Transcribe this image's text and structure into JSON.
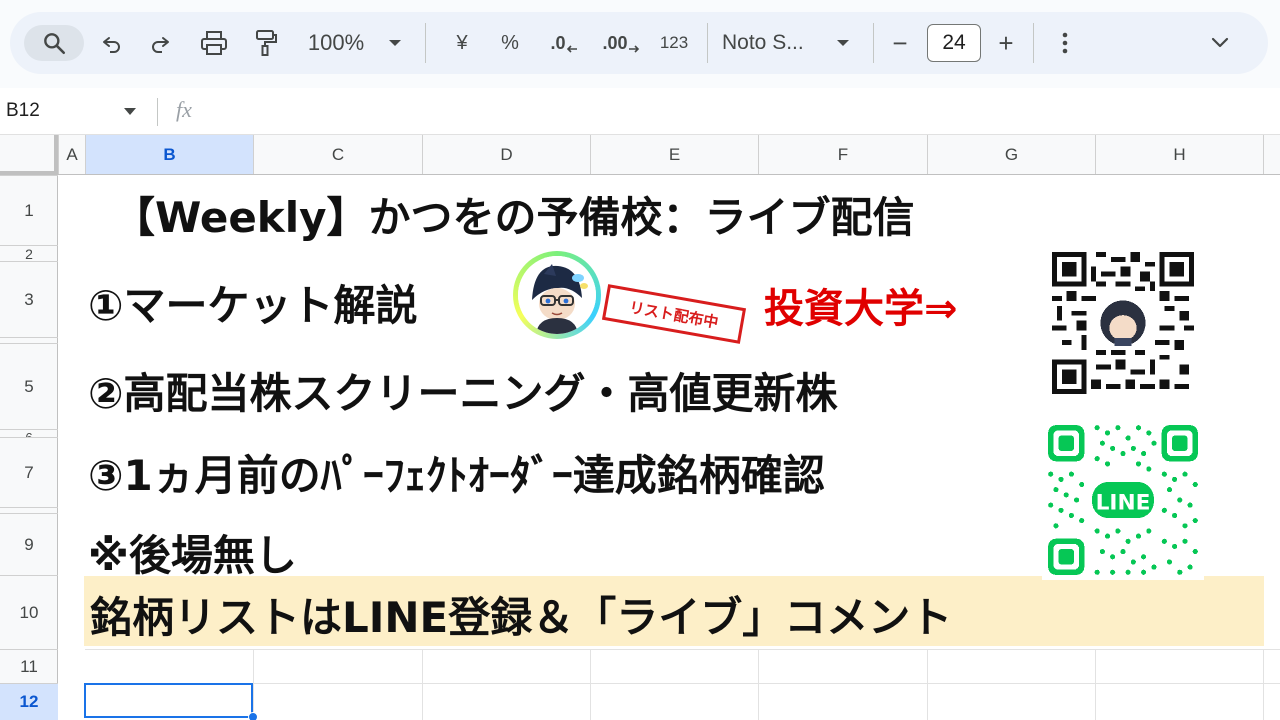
{
  "toolbar": {
    "zoom": "100%",
    "currency_symbol": "¥",
    "percent_symbol": "%",
    "decrease_decimal": ".0",
    "increase_decimal": ".00",
    "number_format": "123",
    "font_name": "Noto S...",
    "font_size": "24",
    "minus": "−",
    "plus": "+"
  },
  "formula_bar": {
    "cell_ref": "B12",
    "fx_label": "fx"
  },
  "columns": [
    "A",
    "B",
    "C",
    "D",
    "E",
    "F",
    "G",
    "H"
  ],
  "selected_column": "B",
  "rows": [
    "1",
    "2",
    "3",
    "",
    "5",
    "6",
    "7",
    "",
    "9",
    "10",
    "11",
    "12"
  ],
  "selected_row": "12",
  "content": {
    "title": "【Weekly】かつをの予備校：ライブ配信",
    "item1": "①マーケット解説",
    "stamp": "リスト配布中",
    "red_link": "投資大学⇒",
    "item2": "②高配当株スクリーニング・高値更新株",
    "item3": "③1ヵ月前のﾊﾟｰﾌｪｸﾄｵｰﾀﾞｰ達成銘柄確認",
    "note": "※後場無し",
    "banner": "銘柄リストはLINE登録＆「ライブ」コメント",
    "line_qr_label": "LINE"
  },
  "colors": {
    "toolbar_bg": "#edf2fa",
    "selection": "#1a73e8",
    "highlight_band": "#fdefc8",
    "red_text": "#e00000",
    "line_green": "#06c755"
  },
  "icons": {
    "search": "search-icon",
    "undo": "undo-icon",
    "redo": "redo-icon",
    "print": "print-icon",
    "paint_format": "paint-format-icon",
    "more": "more-vert-icon",
    "collapse": "chevron-down-icon"
  }
}
